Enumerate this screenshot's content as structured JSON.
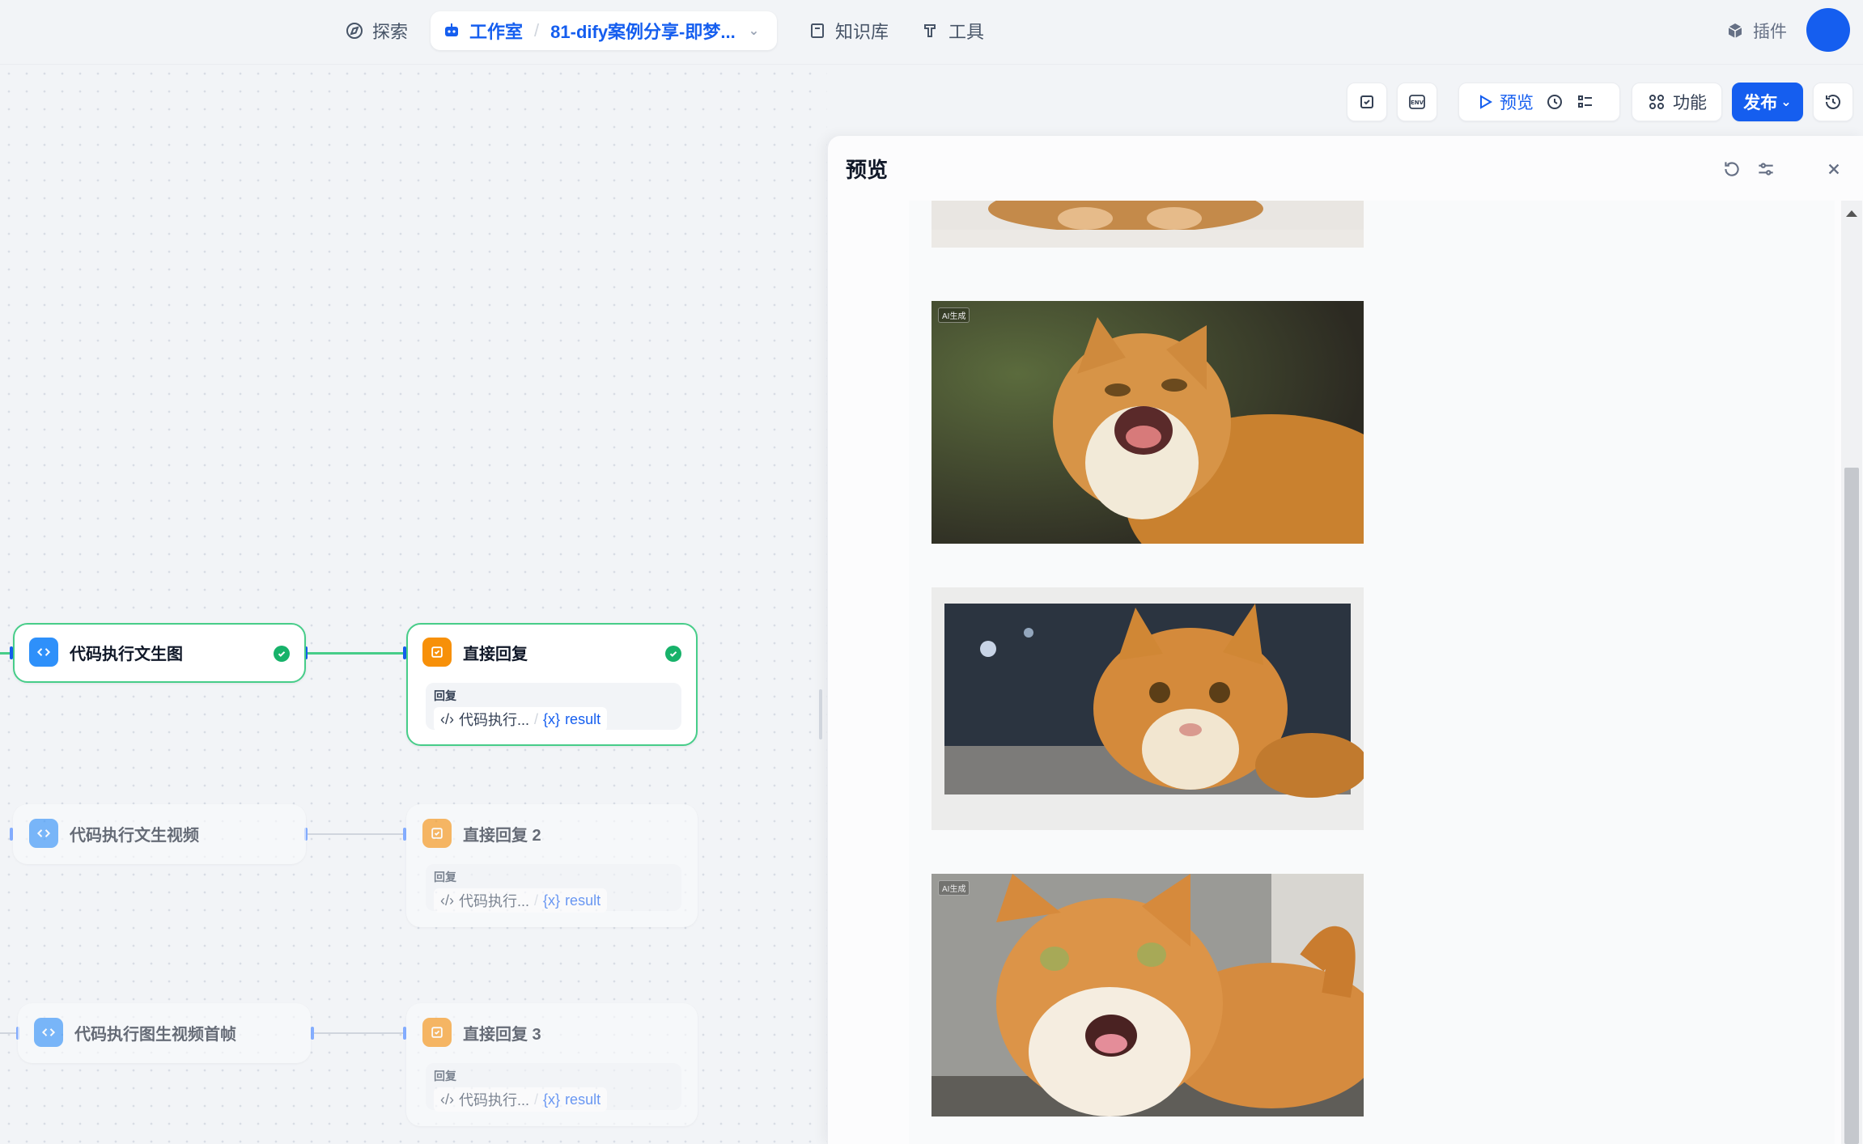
{
  "topnav": {
    "explore": "探索",
    "studio": "工作室",
    "app_name": "81-dify案例分享-即梦...",
    "knowledge": "知识库",
    "tools": "工具",
    "plugins": "插件"
  },
  "toolbar": {
    "env": "ENV",
    "preview": "预览",
    "features": "功能",
    "publish": "发布"
  },
  "panel": {
    "title": "预览"
  },
  "images": {
    "ai_tag": "AI生成"
  },
  "nodes": {
    "code1": "代码执行文生图",
    "reply1": "直接回复",
    "code2": "代码执行文生视频",
    "reply2": "直接回复 2",
    "code3": "代码执行图生视频首帧",
    "reply3": "直接回复 3",
    "reply_label": "回复",
    "var_source": "代码执行...",
    "var_name": "result"
  },
  "colors": {
    "accent": "#155eef",
    "success": "#17b26a",
    "code_node": "#2e90fa",
    "reply_node": "#f79009"
  }
}
